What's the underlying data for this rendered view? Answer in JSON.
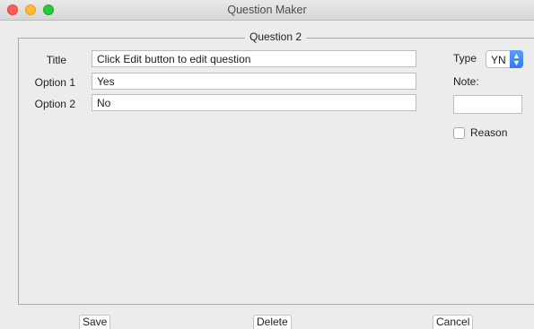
{
  "window": {
    "title": "Question Maker"
  },
  "group": {
    "legend": "Question 2"
  },
  "form": {
    "title_label": "Title",
    "title_value": "Click Edit button to edit question",
    "option1_label": "Option 1",
    "option1_value": "Yes",
    "option2_label": "Option 2",
    "option2_value": "No"
  },
  "side": {
    "type_label": "Type",
    "type_value": "YN",
    "note_label": "Note:",
    "note_value": "",
    "reason_label": "Reason",
    "reason_checked": false
  },
  "buttons": {
    "save": "Save",
    "delete": "Delete",
    "cancel": "Cancel"
  }
}
